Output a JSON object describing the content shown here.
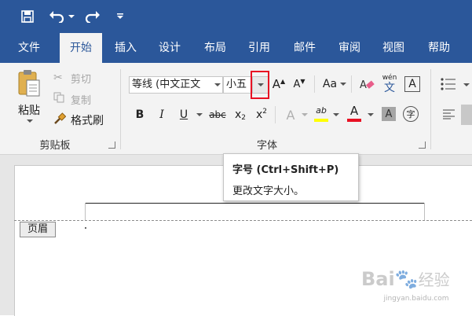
{
  "quick_access": {
    "save_icon": "save-icon",
    "undo_icon": "undo-icon",
    "redo_icon": "redo-icon",
    "customize_icon": "customize-qat-icon"
  },
  "tabs": [
    {
      "label": "文件"
    },
    {
      "label": "开始"
    },
    {
      "label": "插入"
    },
    {
      "label": "设计"
    },
    {
      "label": "布局"
    },
    {
      "label": "引用"
    },
    {
      "label": "邮件"
    },
    {
      "label": "审阅"
    },
    {
      "label": "视图"
    },
    {
      "label": "帮助"
    }
  ],
  "clipboard": {
    "paste_label": "粘贴",
    "cut_label": "剪切",
    "copy_label": "复制",
    "format_painter_label": "格式刷",
    "group_label": "剪贴板"
  },
  "font": {
    "font_name_value": "等线 (中文正文",
    "font_size_value": "小五",
    "group_label": "字体",
    "grow_font_label": "A",
    "shrink_font_label": "A",
    "change_case_label": "Aa",
    "phonetic_top": "wén",
    "phonetic_bottom": "文",
    "char_border_label": "A",
    "bold_label": "B",
    "italic_label": "I",
    "underline_label": "U",
    "strike_label": "abc",
    "subscript_base": "x",
    "subscript_mark": "2",
    "superscript_base": "x",
    "superscript_mark": "2",
    "text_effects_label": "A",
    "highlight_label": "ab",
    "font_color_label": "A",
    "char_shading_label": "A",
    "enclose_label": "字",
    "highlight_color": "#ffff00",
    "font_color_color": "#e81123"
  },
  "tooltip": {
    "title": "字号 (Ctrl+Shift+P)",
    "description": "更改文字大小。"
  },
  "document": {
    "header_tag": "页眉"
  },
  "watermark": {
    "brand": "Bai",
    "brand_cn": "经验",
    "url": "jingyan.baidu.com"
  },
  "colors": {
    "ribbon_blue": "#2b579a",
    "highlight_box": "#e81123"
  }
}
